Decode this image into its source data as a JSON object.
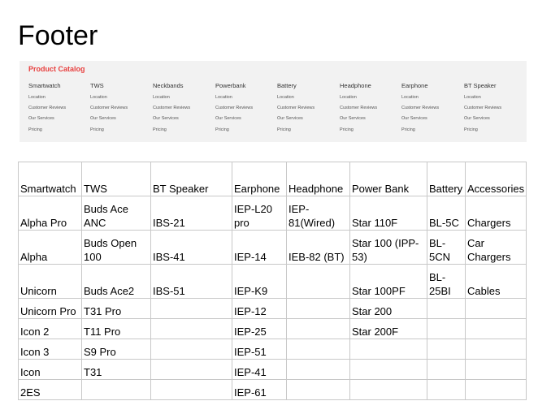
{
  "title": "Footer",
  "footer": {
    "brand": "Product Catalog",
    "columns": [
      {
        "heading": "Smartwatch",
        "links": [
          "Location",
          "Customer Reviews",
          "Our Services",
          "Pricing"
        ]
      },
      {
        "heading": "TWS",
        "links": [
          "Location",
          "Customer Reviews",
          "Our Services",
          "Pricing"
        ]
      },
      {
        "heading": "Neckbands",
        "links": [
          "Location",
          "Customer Reviews",
          "Our Services",
          "Pricing"
        ]
      },
      {
        "heading": "Powerbank",
        "links": [
          "Location",
          "Customer Reviews",
          "Our Services",
          "Pricing"
        ]
      },
      {
        "heading": "Battery",
        "links": [
          "Location",
          "Customer Reviews",
          "Our Services",
          "Pricing"
        ]
      },
      {
        "heading": "Headphone",
        "links": [
          "Location",
          "Customer Reviews",
          "Our Services",
          "Pricing"
        ]
      },
      {
        "heading": "Earphone",
        "links": [
          "Location",
          "Customer Reviews",
          "Our Services",
          "Pricing"
        ]
      },
      {
        "heading": "BT Speaker",
        "links": [
          "Location",
          "Customer Reviews",
          "Our Services",
          "Pricing"
        ]
      }
    ]
  },
  "table": {
    "headers": [
      "Smartwatch",
      "TWS",
      "BT Speaker",
      "Earphone",
      "Headphone",
      "Power Bank",
      "Battery",
      "Accessories"
    ],
    "rows": [
      [
        "Alpha Pro",
        "Buds Ace ANC",
        "IBS-21",
        "IEP-L20 pro",
        "IEP-81(Wired)",
        "Star 110F",
        "BL-5C",
        "Chargers"
      ],
      [
        "Alpha",
        "Buds Open 100",
        "IBS-41",
        "IEP-14",
        "IEB-82 (BT)",
        "Star 100 (IPP-53)",
        "BL-5CN",
        "Car Chargers"
      ],
      [
        "Unicorn",
        "Buds Ace2",
        "IBS-51",
        "IEP-K9",
        "",
        "Star 100PF",
        "BL-25BI",
        "Cables"
      ],
      [
        "Unicorn Pro",
        "T31 Pro",
        "",
        "IEP-12",
        "",
        "Star 200",
        "",
        ""
      ],
      [
        "Icon 2",
        "T11 Pro",
        "",
        "IEP-25",
        "",
        "Star 200F",
        "",
        ""
      ],
      [
        "Icon 3",
        "S9 Pro",
        "",
        "IEP-51",
        "",
        "",
        "",
        ""
      ],
      [
        "Icon",
        "T31",
        "",
        "IEP-41",
        "",
        "",
        "",
        ""
      ],
      [
        "2ES",
        "",
        "",
        "IEP-61",
        "",
        "",
        "",
        ""
      ]
    ]
  }
}
